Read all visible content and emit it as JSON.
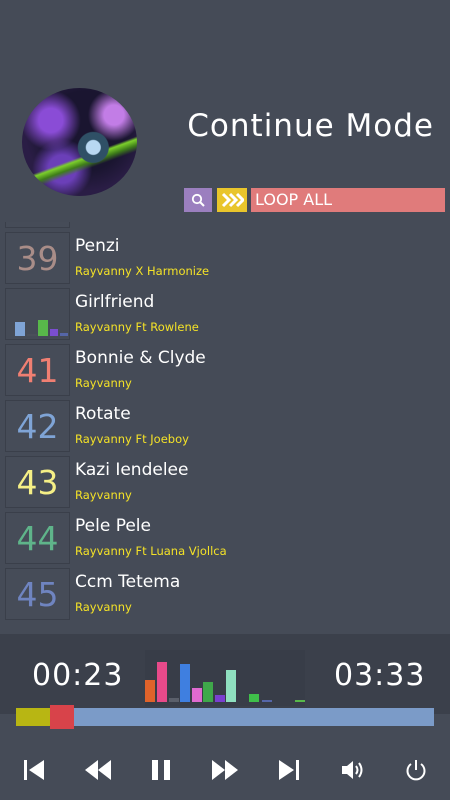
{
  "header": {
    "mode_title": "Continue Mode",
    "loop_mode": "LOOP ALL",
    "search_icon": "search-icon",
    "loop_icon": "double-chevron-right-icon"
  },
  "songs": [
    {
      "number": "39",
      "number_color": "#a98d88",
      "title": "Penzi",
      "artist": "Rayvanny X Harmonize"
    },
    {
      "number": "",
      "number_color": "",
      "title": "Girlfriend",
      "artist": "Rayvanny Ft Rowlene",
      "playing": true
    },
    {
      "number": "41",
      "number_color": "#f07f72",
      "title": "Bonnie & Clyde",
      "artist": "Rayvanny"
    },
    {
      "number": "42",
      "number_color": "#7fa4d6",
      "title": "Rotate",
      "artist": "Rayvanny Ft Joeboy"
    },
    {
      "number": "43",
      "number_color": "#f5ef86",
      "title": "Kazi Iendelee",
      "artist": "Rayvanny"
    },
    {
      "number": "44",
      "number_color": "#5fb48a",
      "title": "Pele Pele",
      "artist": "Rayvanny Ft Luana Vjollca"
    },
    {
      "number": "45",
      "number_color": "#6f84c0",
      "title": "Ccm Tetema",
      "artist": "Rayvanny"
    }
  ],
  "player": {
    "elapsed": "00:23",
    "duration": "03:33",
    "progress": 0.11,
    "icons": [
      "skip-previous-icon",
      "rewind-icon",
      "pause-icon",
      "fast-forward-icon",
      "skip-next-icon",
      "volume-icon",
      "power-icon"
    ]
  }
}
